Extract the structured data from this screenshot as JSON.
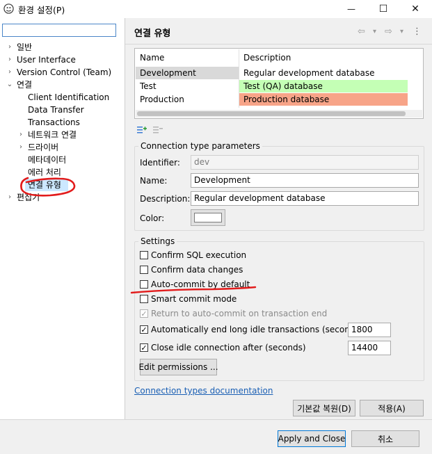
{
  "window": {
    "title": "환경 설정(P)",
    "minimize_glyph": "—",
    "maximize_glyph": "☐",
    "close_glyph": "✕"
  },
  "sidebar": {
    "filter_value": "",
    "items": [
      {
        "label": "일반",
        "expander": "›"
      },
      {
        "label": "User Interface",
        "expander": "›"
      },
      {
        "label": "Version Control (Team)",
        "expander": "›"
      },
      {
        "label": "연결",
        "expander": "⌄"
      },
      {
        "label": "Client Identification",
        "expander": ""
      },
      {
        "label": "Data Transfer",
        "expander": ""
      },
      {
        "label": "Transactions",
        "expander": ""
      },
      {
        "label": "네트워크 연결",
        "expander": "›"
      },
      {
        "label": "드라이버",
        "expander": "›"
      },
      {
        "label": "메타데이터",
        "expander": ""
      },
      {
        "label": "에러 처리",
        "expander": ""
      },
      {
        "label": "연결 유형",
        "expander": ""
      },
      {
        "label": "편집기",
        "expander": "›"
      }
    ]
  },
  "page": {
    "title": "연결 유형",
    "nav_back_icon": "⇦",
    "nav_forward_icon": "⇨",
    "dropdown_icon": "▾",
    "menu_icon": "⋮"
  },
  "types_table": {
    "headers": [
      "Name",
      "Description"
    ],
    "rows": [
      {
        "name": "Development",
        "description": "Regular development database",
        "color": "#ffffff"
      },
      {
        "name": "Test",
        "description": "Test (QA) database",
        "color": "#c4ffb5"
      },
      {
        "name": "Production",
        "description": "Production database",
        "color": "#f7a488"
      }
    ]
  },
  "table_tools": {
    "add_icon": "add-row-icon",
    "remove_icon": "remove-row-icon"
  },
  "params": {
    "group_label": "Connection type parameters",
    "identifier_label": "Identifier:",
    "identifier_value": "dev",
    "name_label": "Name:",
    "name_value": "Development",
    "description_label": "Description:",
    "description_value": "Regular development database",
    "color_label": "Color:",
    "color_value": "#ffffff"
  },
  "settings": {
    "group_label": "Settings",
    "confirm_sql": {
      "label": "Confirm SQL execution",
      "checked": false
    },
    "confirm_data": {
      "label": "Confirm data changes",
      "checked": false
    },
    "auto_commit": {
      "label": "Auto-commit by default",
      "checked": false
    },
    "smart_commit": {
      "label": "Smart commit mode",
      "checked": false
    },
    "return_auto_commit": {
      "label": "Return to auto-commit on transaction end",
      "checked": true
    },
    "auto_end_idle": {
      "label": "Automatically end long idle transactions (seconds)",
      "checked": true,
      "value": "1800"
    },
    "close_idle": {
      "label": "Close idle connection after (seconds)",
      "checked": true,
      "value": "14400"
    },
    "edit_permissions_label": "Edit permissions ..."
  },
  "docs_link": "Connection types documentation",
  "restore_defaults_label": "기본값 복원(D)",
  "apply_label": "적용(A)",
  "apply_close_label": "Apply and Close",
  "cancel_label": "취소",
  "check_glyph": "✓"
}
